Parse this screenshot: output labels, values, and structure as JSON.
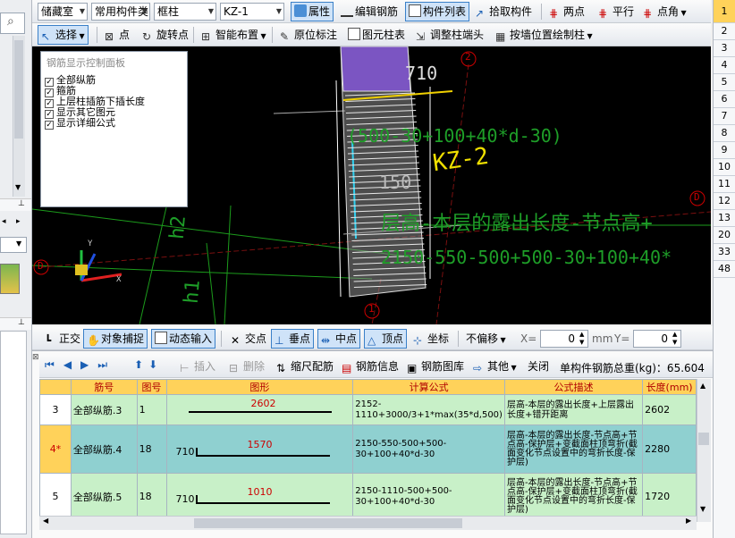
{
  "toolbar1": {
    "floor": "储藏室",
    "category": "常用构件类",
    "type": "框柱",
    "component": "KZ-1",
    "buttons": [
      "属性",
      "编辑钢筋",
      "构件列表",
      "拾取构件",
      "两点",
      "平行",
      "点角"
    ]
  },
  "toolbar2": {
    "buttons": [
      "选择",
      "点",
      "旋转点",
      "智能布置",
      "原位标注",
      "图元柱表",
      "调整柱端头",
      "按墙位置绘制柱"
    ]
  },
  "rows": [
    "1",
    "2",
    "3",
    "4",
    "5",
    "6",
    "7",
    "8",
    "9",
    "10",
    "11",
    "12",
    "13",
    "20",
    "33",
    "48"
  ],
  "panel": {
    "title": "钢筋显示控制面板",
    "items": [
      "全部纵筋",
      "箍筋",
      "上层柱插筋下插长度",
      "显示其它图元",
      "显示详细公式"
    ]
  },
  "cad": {
    "label710": "710",
    "axis2": "2",
    "axis1": "1",
    "axisD1": "D",
    "axisD2": "D",
    "formula1": "(500-30+100+40*d-30)",
    "name": "KZ-2",
    "dim150": "150",
    "desc": "层高-本层的露出长度-节点高+",
    "formula2": "2150-550-500+500-30+100+40*",
    "h1": "h1",
    "h2": "h2",
    "axisX": "X",
    "axisY": "Y"
  },
  "snapbar": {
    "items": [
      "正交",
      "对象捕捉",
      "动态输入",
      "交点",
      "垂点",
      "中点",
      "顶点",
      "坐标",
      "不偏移"
    ],
    "x_label": "X=",
    "x_val": "0",
    "unit": "mm",
    "y_label": "Y=",
    "y_val": "0"
  },
  "gridtool": {
    "items": [
      "插入",
      "删除",
      "缩尺配筋",
      "钢筋信息",
      "钢筋图库",
      "其他",
      "关闭"
    ],
    "total": "单构件钢筋总重(kg)：65.604"
  },
  "table": {
    "headers": [
      "",
      "筋号",
      "图号",
      "图形",
      "计算公式",
      "公式描述",
      "长度(mm)"
    ],
    "rows": [
      {
        "no": "3",
        "name": "全部纵筋.3",
        "fig": "1",
        "shape_left": "",
        "shape_val": "2602",
        "formula": "2152-1110+3000/3+1*max(35*d,500)",
        "desc": "层高-本层的露出长度+上层露出长度+错开距离",
        "length": "2602"
      },
      {
        "no": "4*",
        "name": "全部纵筋.4",
        "fig": "18",
        "shape_left": "710",
        "shape_val": "1570",
        "formula": "2150-550-500+500-30+100+40*d-30",
        "desc": "层高-本层的露出长度-节点高+节点高-保护层+变截面柱顶弯折(截面变化节点设置中的弯折长度-保护层)",
        "length": "2280"
      },
      {
        "no": "5",
        "name": "全部纵筋.5",
        "fig": "18",
        "shape_left": "710",
        "shape_val": "1010",
        "formula": "2150-1110-500+500-30+100+40*d-30",
        "desc": "层高-本层的露出长度-节点高+节点高-保护层+变截面柱顶弯折(截面变化节点设置中的弯折长度-保护层)",
        "length": "1720"
      }
    ]
  }
}
